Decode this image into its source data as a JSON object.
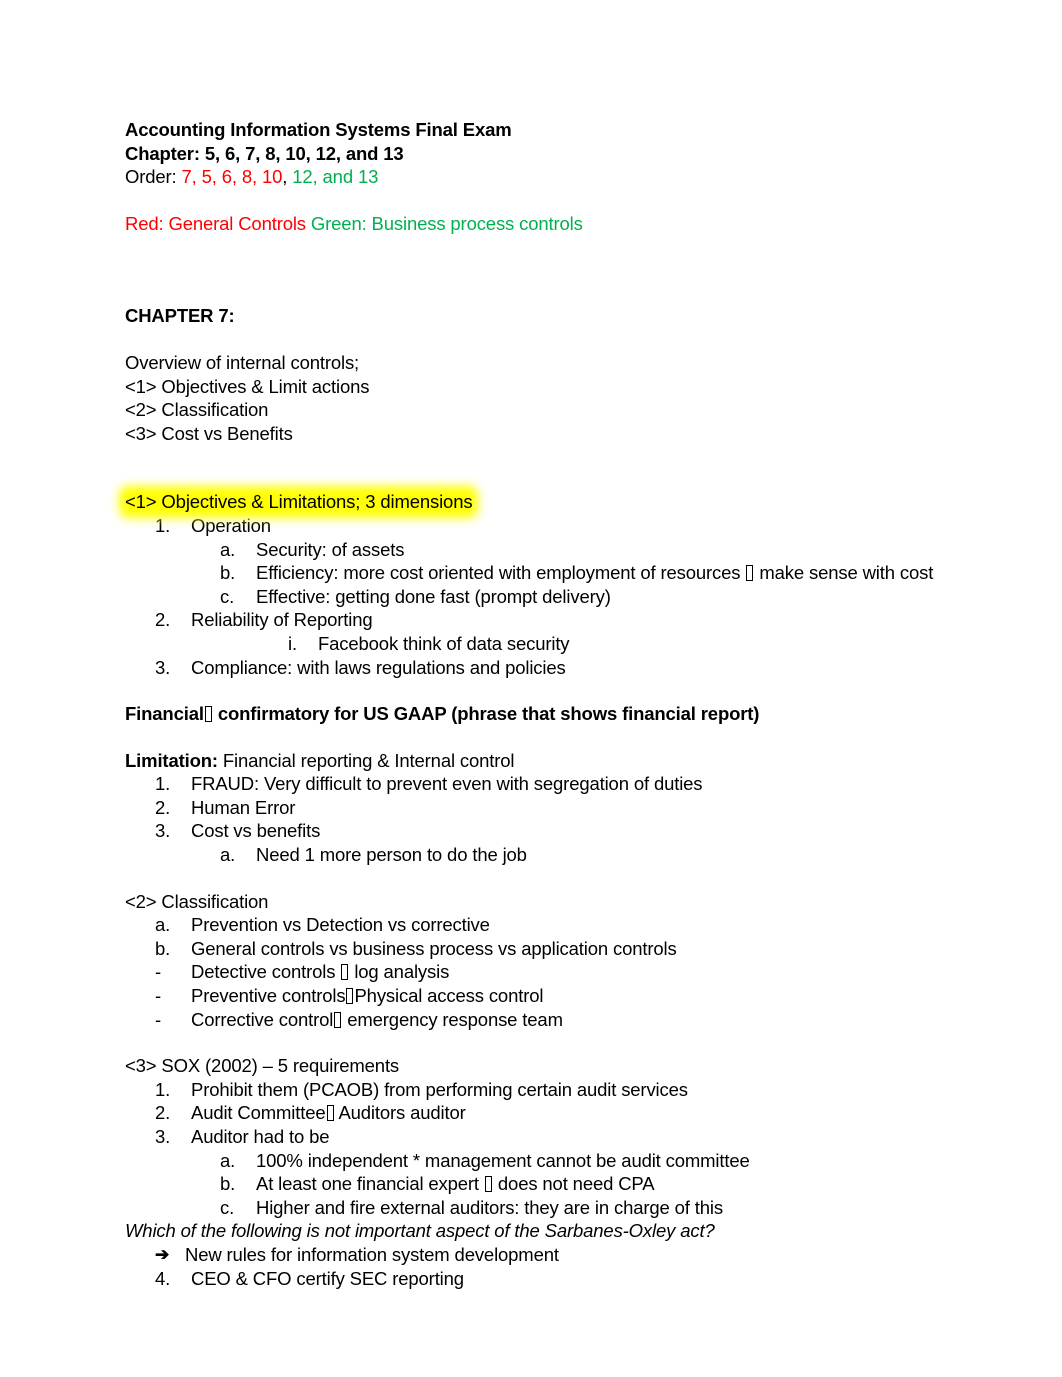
{
  "document": {
    "title_line_1": "Accounting Information Systems Final Exam",
    "title_line_2": "Chapter: 5, 6, 7, 8, 10, 12, and 13",
    "order": {
      "label": "Order: ",
      "red_part": "7, 5, 6, 8, 10",
      "separator": ", ",
      "green_part": "12, and 13"
    },
    "legend": {
      "red": "Red: General Controls",
      "green": " Green: Business process controls"
    },
    "chapter_heading": "CHAPTER 7:",
    "overview": {
      "intro": "Overview of internal controls;",
      "item_1": "<1> Objectives & Limit actions",
      "item_2": "<2> Classification",
      "item_3": "<3> Cost vs Benefits"
    },
    "section_1": {
      "heading_highlighted": "<1> Objectives & Limitations; 3 dimensions",
      "items": [
        {
          "marker": "1.",
          "text": "Operation"
        },
        {
          "marker": "a.",
          "text": "Security: of assets"
        },
        {
          "marker": "b.",
          "text_before": "Efficiency: more cost oriented with employment of resources ",
          "glyph": "missing-glyph-box",
          "text_after": " make sense with cost"
        },
        {
          "marker": "c.",
          "text": "Effective: getting done fast (prompt delivery)"
        },
        {
          "marker": "2.",
          "text": "Reliability of Reporting"
        },
        {
          "marker": "i.",
          "text": "Facebook think of data security"
        },
        {
          "marker": "3.",
          "text": "Compliance: with laws regulations and policies"
        }
      ]
    },
    "financial_line": {
      "before": "Financial",
      "glyph": "missing-glyph-box",
      "after": " confirmatory for US GAAP (phrase that shows financial report)"
    },
    "limitation": {
      "label": "Limitation:",
      "rest": " Financial reporting & Internal control",
      "items": [
        {
          "marker": "1.",
          "text": "FRAUD: Very difficult to prevent even with segregation of duties"
        },
        {
          "marker": "2.",
          "text": "Human Error"
        },
        {
          "marker": "3.",
          "text": "Cost vs benefits"
        },
        {
          "marker": "a.",
          "text": "Need 1 more person to do the job"
        }
      ]
    },
    "section_2": {
      "heading": "<2> Classification",
      "items": [
        {
          "marker": "a.",
          "text": "Prevention vs Detection vs corrective"
        },
        {
          "marker": "b.",
          "text": "General controls vs business process vs application controls"
        },
        {
          "marker": "-",
          "text_before": "Detective controls ",
          "glyph": "missing-glyph-box",
          "text_after": " log analysis"
        },
        {
          "marker": "-",
          "text_before": "Preventive controls",
          "glyph": "missing-glyph-box",
          "text_after": "Physical access control"
        },
        {
          "marker": "-",
          "text_before": "Corrective control",
          "glyph": "missing-glyph-box",
          "text_after": " emergency response team"
        }
      ]
    },
    "section_3": {
      "heading": "<3> SOX (2002) – 5 requirements",
      "items": [
        {
          "marker": "1.",
          "text": "Prohibit them (PCAOB) from performing certain audit services"
        },
        {
          "marker": "2.",
          "text_before": "Audit Committee",
          "glyph": "missing-glyph-box",
          "text_after": " Auditors auditor"
        },
        {
          "marker": "3.",
          "text": "Auditor had to be"
        },
        {
          "marker": "a.",
          "text": "100% independent * management cannot be audit committee"
        },
        {
          "marker": "b.",
          "text_before": "At least one financial expert ",
          "glyph": "missing-glyph-box",
          "text_after": " does not need CPA"
        },
        {
          "marker": "c.",
          "text": "Higher and fire external auditors: they are in charge of this"
        }
      ],
      "question": "Which of the following is not important aspect of the Sarbanes-Oxley act?",
      "answer": {
        "marker": "➔",
        "text": "New rules for information system development"
      },
      "item_4": {
        "marker": "4.",
        "text": "CEO & CFO certify SEC reporting"
      }
    },
    "colors": {
      "red": "#FF0000",
      "green": "#00B050",
      "highlight": "#FFFF00",
      "text": "#000000",
      "background": "#FFFFFF"
    }
  }
}
